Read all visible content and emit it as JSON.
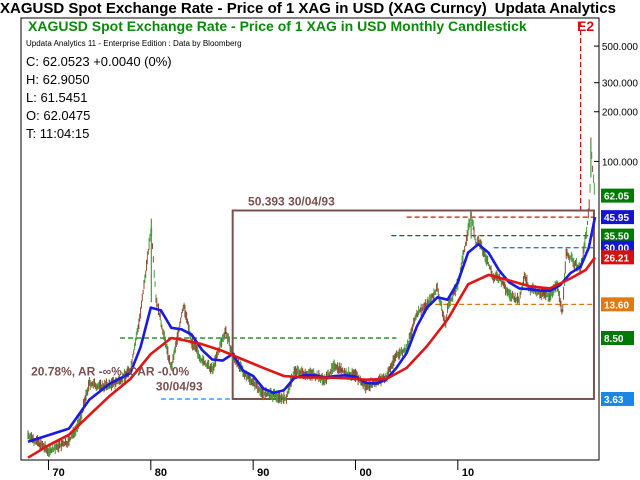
{
  "window": {
    "title": "XAGUSD Spot Exchange Rate - Price of 1 XAG in USD (XAG Curncy)",
    "app_name": "Updata Analytics"
  },
  "chart_data": {
    "type": "candlestick",
    "title": "XAGUSD Spot Exchange Rate - Price of 1 XAG in USD Monthly Candlestick",
    "subtitle": "Updata Analytics 11 - Enterprise Edition : Data by Bloomberg",
    "corner_label": "E2",
    "y_scale": "log",
    "ylim": [
      3.2,
      700
    ],
    "xlim": [
      1968,
      2023.5
    ],
    "ohlc_readout": {
      "close": "C: 62.0523  +0.0040 (0%)",
      "high": "H: 62.9050",
      "low": "L: 61.5451",
      "open": "O: 62.0475",
      "time": "T: 11:04:15"
    },
    "y_ticks": [
      {
        "value": 500,
        "label": "500.000"
      },
      {
        "value": 300,
        "label": "300.000"
      },
      {
        "value": 200,
        "label": "200.000"
      },
      {
        "value": 100,
        "label": "100.000"
      }
    ],
    "x_ticks": [
      {
        "value": 1970,
        "label": "70"
      },
      {
        "value": 1980,
        "label": "80"
      },
      {
        "value": 1990,
        "label": "90"
      },
      {
        "value": 2000,
        "label": "00"
      },
      {
        "value": 2010,
        "label": "10"
      }
    ],
    "price_tags": [
      {
        "value": 62.05,
        "label": "62.05",
        "bg": "#007a00",
        "fg": "#ffffff"
      },
      {
        "value": 45.95,
        "label": "45.95",
        "bg": "#1515d0",
        "fg": "#ffffff"
      },
      {
        "value": 35.5,
        "label": "35.50",
        "bg": "#007a00",
        "fg": "#ffffff"
      },
      {
        "value": 30.0,
        "label": "30.00",
        "bg": "#1515d0",
        "fg": "#ffffff"
      },
      {
        "value": 26.21,
        "label": "26.21",
        "bg": "#d41010",
        "fg": "#ffffff"
      },
      {
        "value": 13.6,
        "label": "13.60",
        "bg": "#e07a10",
        "fg": "#ffffff"
      },
      {
        "value": 8.5,
        "label": "8.50",
        "bg": "#007a00",
        "fg": "#ffffff"
      },
      {
        "value": 3.63,
        "label": "3.63",
        "bg": "#1a86e8",
        "fg": "#ffffff"
      }
    ],
    "price_path": [
      [
        1968,
        2.2
      ],
      [
        1970,
        1.75
      ],
      [
        1972,
        2.0
      ],
      [
        1973,
        2.6
      ],
      [
        1974,
        4.5
      ],
      [
        1975,
        4.3
      ],
      [
        1976,
        4.4
      ],
      [
        1977,
        4.7
      ],
      [
        1978,
        5.4
      ],
      [
        1979,
        12.0
      ],
      [
        1980.05,
        40.0
      ],
      [
        1980.5,
        15.0
      ],
      [
        1981,
        10.5
      ],
      [
        1982,
        5.5
      ],
      [
        1982.8,
        10.0
      ],
      [
        1983.2,
        13.5
      ],
      [
        1984,
        8.0
      ],
      [
        1985,
        6.2
      ],
      [
        1986,
        5.4
      ],
      [
        1987.3,
        9.5
      ],
      [
        1988,
        6.6
      ],
      [
        1989,
        5.3
      ],
      [
        1990,
        4.6
      ],
      [
        1991,
        3.9
      ],
      [
        1992,
        3.8
      ],
      [
        1993.2,
        3.63
      ],
      [
        1994,
        5.3
      ],
      [
        1995,
        5.2
      ],
      [
        1996,
        5.1
      ],
      [
        1997,
        4.7
      ],
      [
        1998,
        5.8
      ],
      [
        1999,
        5.2
      ],
      [
        2000,
        5.0
      ],
      [
        2001,
        4.3
      ],
      [
        2002,
        4.6
      ],
      [
        2003,
        4.9
      ],
      [
        2004,
        6.7
      ],
      [
        2005,
        7.3
      ],
      [
        2006,
        12.0
      ],
      [
        2007,
        13.5
      ],
      [
        2008,
        17.0
      ],
      [
        2008.8,
        10.0
      ],
      [
        2009,
        13.0
      ],
      [
        2010,
        18.0
      ],
      [
        2011.3,
        48.0
      ],
      [
        2011.8,
        31.0
      ],
      [
        2012,
        33.0
      ],
      [
        2013,
        24.0
      ],
      [
        2013.5,
        19.5
      ],
      [
        2014,
        20.0
      ],
      [
        2015,
        15.5
      ],
      [
        2016,
        14.2
      ],
      [
        2016.5,
        20.5
      ],
      [
        2017,
        17.0
      ],
      [
        2018,
        15.8
      ],
      [
        2019,
        15.3
      ],
      [
        2019.7,
        17.8
      ],
      [
        2020.2,
        12.0
      ],
      [
        2020.6,
        28.0
      ],
      [
        2021,
        26.0
      ],
      [
        2022,
        22.0
      ],
      [
        2022.6,
        38.0
      ],
      [
        2022.9,
        60.0
      ],
      [
        2023.0,
        130.0
      ],
      [
        2023.2,
        85.0
      ],
      [
        2023.4,
        62.05
      ]
    ],
    "moving_averages": [
      {
        "name": "fast",
        "color": "#1a1ae0",
        "points": [
          [
            1968,
            2.0
          ],
          [
            1972,
            2.4
          ],
          [
            1974,
            3.6
          ],
          [
            1976,
            4.5
          ],
          [
            1978,
            5.2
          ],
          [
            1979,
            7.5
          ],
          [
            1980,
            13.0
          ],
          [
            1981,
            12.5
          ],
          [
            1982,
            9.8
          ],
          [
            1983,
            9.6
          ],
          [
            1984,
            8.9
          ],
          [
            1985,
            7.2
          ],
          [
            1986,
            6.3
          ],
          [
            1987,
            6.2
          ],
          [
            1988,
            6.8
          ],
          [
            1989,
            5.4
          ],
          [
            1990,
            5.0
          ],
          [
            1991,
            4.2
          ],
          [
            1992,
            3.95
          ],
          [
            1993,
            4.1
          ],
          [
            1994,
            4.85
          ],
          [
            1995,
            5.05
          ],
          [
            1996,
            5.05
          ],
          [
            1997,
            4.9
          ],
          [
            1998,
            5.0
          ],
          [
            1999,
            5.05
          ],
          [
            2000,
            4.95
          ],
          [
            2001,
            4.55
          ],
          [
            2002,
            4.5
          ],
          [
            2003,
            4.75
          ],
          [
            2004,
            5.6
          ],
          [
            2005,
            6.9
          ],
          [
            2006,
            10.0
          ],
          [
            2007,
            13.0
          ],
          [
            2008,
            15.0
          ],
          [
            2009,
            14.5
          ],
          [
            2010,
            18.5
          ],
          [
            2011,
            28.0
          ],
          [
            2012,
            31.5
          ],
          [
            2013,
            28.0
          ],
          [
            2014,
            22.0
          ],
          [
            2015,
            18.5
          ],
          [
            2016,
            17.0
          ],
          [
            2017,
            16.8
          ],
          [
            2018,
            16.5
          ],
          [
            2019,
            16.4
          ],
          [
            2020,
            17.8
          ],
          [
            2021,
            21.0
          ],
          [
            2022,
            23.0
          ],
          [
            2022.8,
            30.0
          ],
          [
            2023.4,
            45.95
          ]
        ]
      },
      {
        "name": "slow",
        "color": "#e01515",
        "points": [
          [
            1968,
            1.6
          ],
          [
            1970,
            1.9
          ],
          [
            1972,
            2.2
          ],
          [
            1974,
            2.9
          ],
          [
            1976,
            3.8
          ],
          [
            1978,
            4.8
          ],
          [
            1980,
            6.8
          ],
          [
            1982,
            8.5
          ],
          [
            1983,
            8.3
          ],
          [
            1985,
            7.8
          ],
          [
            1987,
            7.1
          ],
          [
            1989,
            6.3
          ],
          [
            1991,
            5.6
          ],
          [
            1993,
            5.0
          ],
          [
            1995,
            4.9
          ],
          [
            1997,
            4.9
          ],
          [
            1999,
            4.85
          ],
          [
            2001,
            4.75
          ],
          [
            2003,
            4.8
          ],
          [
            2005,
            5.6
          ],
          [
            2007,
            7.6
          ],
          [
            2009,
            11.0
          ],
          [
            2011,
            18.0
          ],
          [
            2013,
            20.5
          ],
          [
            2015,
            19.0
          ],
          [
            2017,
            17.5
          ],
          [
            2019,
            17.0
          ],
          [
            2021,
            19.5
          ],
          [
            2022.5,
            22.0
          ],
          [
            2023.4,
            26.21
          ]
        ]
      }
    ],
    "box": {
      "x0": 1988.0,
      "x1": 2023.3,
      "y0": 3.63,
      "y1": 50.393,
      "color": "#7a5050"
    },
    "annotations": [
      {
        "text": "50.393  30/04/93",
        "x": 1989.5,
        "y": 50.393,
        "color": "#7a5050",
        "anchor": "start"
      },
      {
        "text": "20.78%, AR -∞%, CAR -0.0%",
        "x": 1968.3,
        "y": 4.7,
        "color": "#7a5050",
        "anchor": "start"
      },
      {
        "text": "30/04/93",
        "x": 1980.5,
        "y": 3.8,
        "color": "#7a5050",
        "anchor": "start"
      }
    ],
    "h_lines": [
      {
        "y": 45.95,
        "x0": 2005.0,
        "x1": 2023.3,
        "color": "#d41010"
      },
      {
        "y": 35.5,
        "x0": 2003.5,
        "x1": 2023.3,
        "color": "#007a00"
      },
      {
        "y": 30.0,
        "x0": 2013.5,
        "x1": 2023.3,
        "color": "#1a86e8"
      },
      {
        "y": 13.6,
        "x0": 2007.0,
        "x1": 2023.3,
        "color": "#e07a10"
      },
      {
        "y": 8.5,
        "x0": 1977.0,
        "x1": 2004.0,
        "color": "#007a00"
      },
      {
        "y": 3.63,
        "x0": 1981.0,
        "x1": 2000.0,
        "color": "#1a86e8"
      }
    ],
    "v_lines": [
      {
        "x": 2022.0,
        "y0": 48.0,
        "y1": 700,
        "color": "#d41010"
      }
    ],
    "grid": false,
    "y_axis_position": "right"
  }
}
